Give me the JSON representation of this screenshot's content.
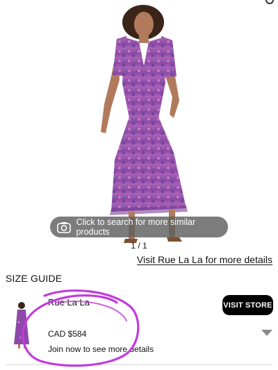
{
  "hero": {
    "visual_search_label": "Click to search for more similar products",
    "pager": "1 / 1"
  },
  "visit_link": "Visit Rue La La for more details",
  "size_guide": "SIZE GUIDE",
  "product": {
    "store_name": "Rue La La",
    "price": "CAD $584",
    "join_text": "Join now to see more details",
    "visit_store_label": "VISIT STORE"
  },
  "colors": {
    "dress_primary": "#9b4fa7",
    "dress_accent": "#5b3f9a",
    "button_bg": "#000000",
    "annotation": "#c23bdc"
  },
  "icons": {
    "camera": "camera-icon",
    "expand": "chevron-down-icon",
    "share": "share-icon"
  }
}
